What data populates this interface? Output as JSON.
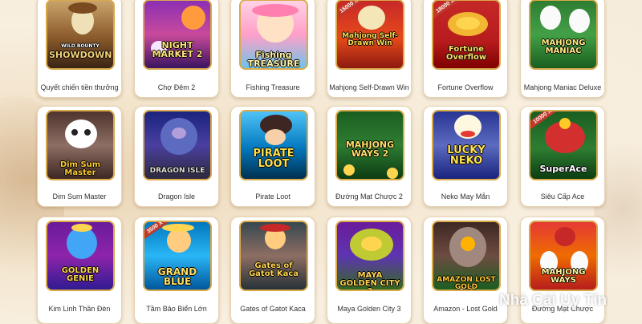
{
  "games": [
    {
      "label": "Quyết chiến tiền thưởng",
      "art_text": "SHOWDOWN",
      "art_sub": "WILD BOUNTY",
      "icon": "cowgirl-gunslinger-icon"
    },
    {
      "label": "Chợ Đêm 2",
      "art_text": "NIGHT MARKET 2",
      "icon": "night-market-icon"
    },
    {
      "label": "Fishing Treasure",
      "art_text": "Fishing TREASURE",
      "icon": "mermaid-icon"
    },
    {
      "label": "Mahjong Self-Drawn Win",
      "art_text": "Mahjong Self-Drawn Win",
      "badge": "15000 X",
      "icon": "mahjong-tile-icon"
    },
    {
      "label": "Fortune Overflow",
      "art_text": "Fortune Overflow",
      "badge": "18000 X",
      "icon": "gold-ingot-icon"
    },
    {
      "label": "Mahjong Maniac Deluxe",
      "art_text": "MAHJONG MANIAC",
      "icon": "mahjong-tiles-icon"
    },
    {
      "label": "Dim Sum Master",
      "art_text": "Dim Sum Master",
      "icon": "panda-chef-icon"
    },
    {
      "label": "Dragon Isle",
      "art_text": "DRAGON ISLE",
      "icon": "dragon-icon"
    },
    {
      "label": "Pirate Loot",
      "art_text": "PIRATE LOOT",
      "icon": "pirate-icon"
    },
    {
      "label": "Đường Mạt Chược 2",
      "art_text": "MAHJONG WAYS 2",
      "icon": "mahjong-ways-icon"
    },
    {
      "label": "Neko May Mắn",
      "art_text": "LUCKY NEKO",
      "icon": "lucky-cat-icon"
    },
    {
      "label": "Siêu Cấp Ace",
      "art_text": "SuperAce",
      "badge": "10000 X",
      "icon": "jester-hat-icon"
    },
    {
      "label": "Kim Linh Thần Đèn",
      "art_text": "GOLDEN GENIE",
      "icon": "genie-icon"
    },
    {
      "label": "Tầm Bảo Biển Lớn",
      "art_text": "GRAND BLUE",
      "badge": "3500 X",
      "icon": "sea-warrior-icon"
    },
    {
      "label": "Gates of Gatot Kaca",
      "art_text": "Gates of Gatot Kaca",
      "icon": "warrior-hero-icon"
    },
    {
      "label": "Maya Golden City 3",
      "art_text": "MAYA GOLDEN CITY 3",
      "icon": "maya-mask-icon"
    },
    {
      "label": "Amazon - Lost Gold",
      "art_text": "AMAZON LOST GOLD",
      "art_sub": "TOP 10",
      "icon": "temple-icon"
    },
    {
      "label": "Đường Mạt Chược",
      "art_text": "MAHJONG WAYS",
      "icon": "mahjong-hu-icon"
    }
  ],
  "watermark": "Nhà Cái Uy Tín",
  "colors": {
    "accent": "#d9a94a",
    "card_bg": "#ffffff",
    "page_bg": "#f6ecdb",
    "label_text": "#333333",
    "badge": "#c0392b"
  }
}
